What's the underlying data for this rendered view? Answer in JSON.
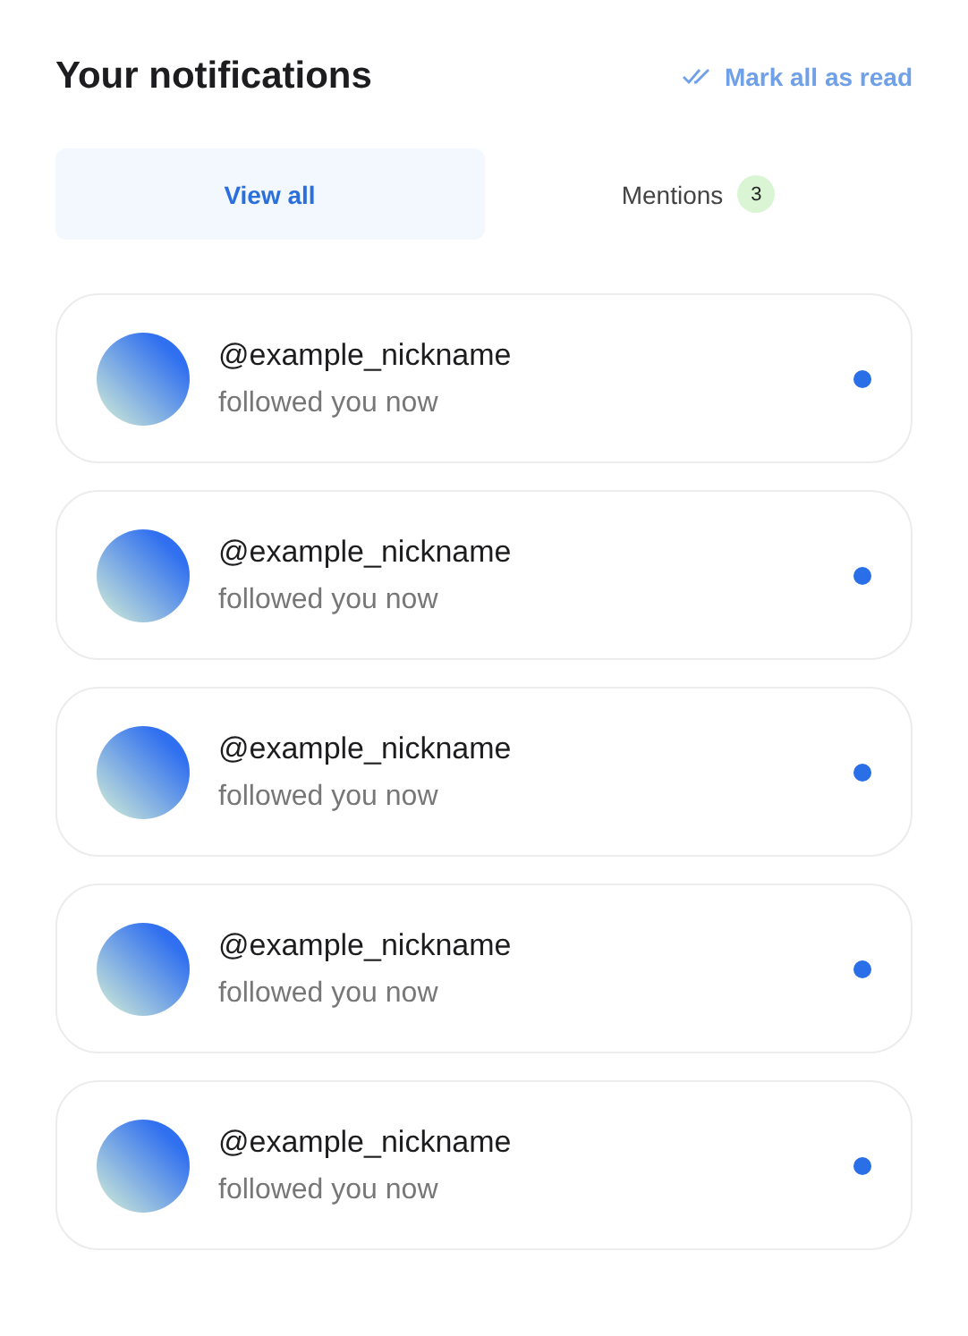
{
  "header": {
    "title": "Your notifications",
    "mark_all": "Mark all as read"
  },
  "tabs": [
    {
      "label": "View all",
      "selected": true
    },
    {
      "label": "Mentions",
      "selected": false,
      "badge": "3"
    }
  ],
  "notifications": [
    {
      "name": "@example_nickname",
      "message": "followed you now",
      "unread": true
    },
    {
      "name": "@example_nickname",
      "message": "followed you now",
      "unread": true
    },
    {
      "name": "@example_nickname",
      "message": "followed you now",
      "unread": true
    },
    {
      "name": "@example_nickname",
      "message": "followed you now",
      "unread": true
    },
    {
      "name": "@example_nickname",
      "message": "followed you now",
      "unread": true
    }
  ]
}
